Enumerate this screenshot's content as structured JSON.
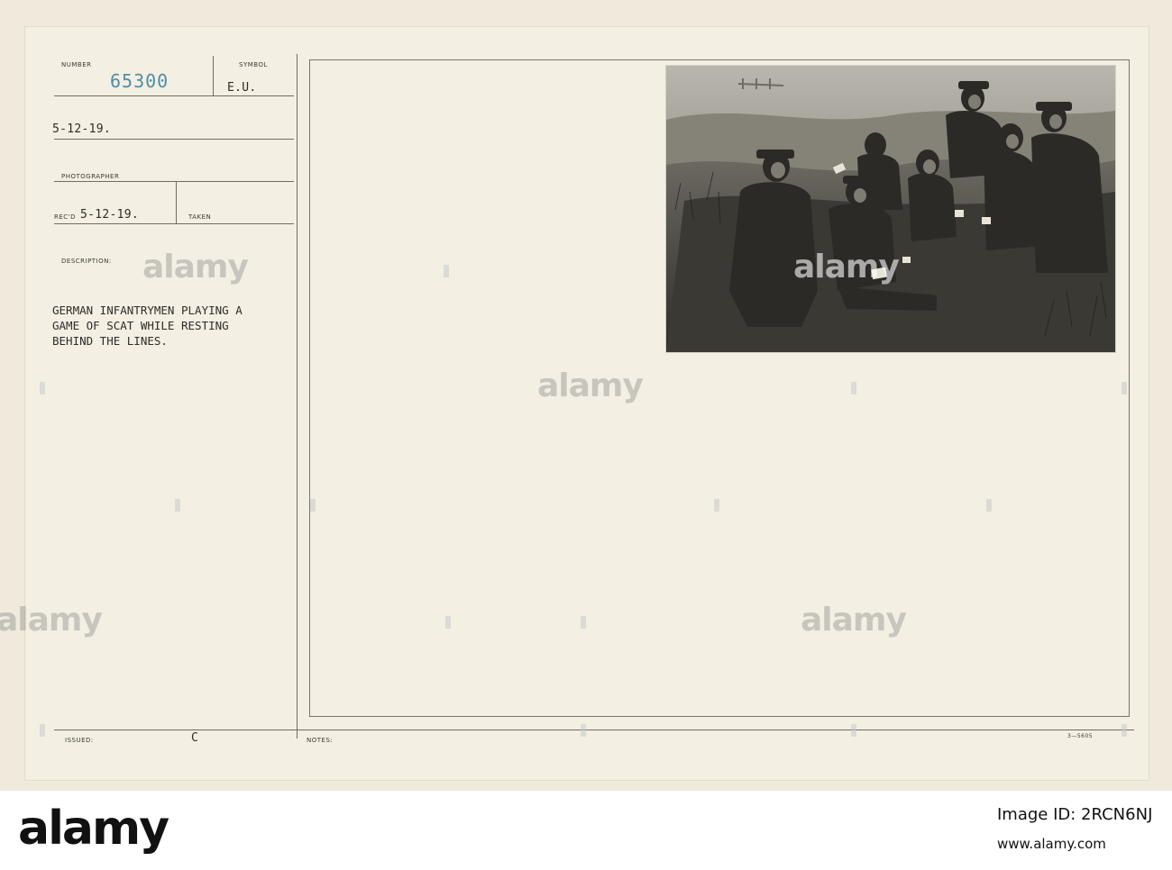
{
  "record": {
    "number_label": "NUMBER",
    "number_value": "65300",
    "symbol_label": "SYMBOL",
    "symbol_value": "E.U.",
    "date_value": "5-12-19.",
    "photographer_label": "PHOTOGRAPHER",
    "recd_label": "REC'D",
    "recd_value": "5-12-19.",
    "taken_label": "TAKEN",
    "description_label": "DESCRIPTION:",
    "description_lines": [
      "GERMAN INFANTRYMEN PLAYING A",
      "GAME OF SCAT WHILE RESTING",
      "BEHIND THE LINES."
    ],
    "issued_label": "ISSUED:",
    "issued_value": "C",
    "notes_label": "NOTES:",
    "form_code": "3—5605"
  },
  "watermark": {
    "text": "alamy"
  },
  "footer": {
    "logo": "alamy",
    "image_id": "Image ID: 2RCN6NJ",
    "site": "www.alamy.com"
  },
  "colors": {
    "card": "#efeadc",
    "stamp_blue": "#4d8fa6",
    "ink": "#2f2c28",
    "rule": "#6f6b62"
  }
}
